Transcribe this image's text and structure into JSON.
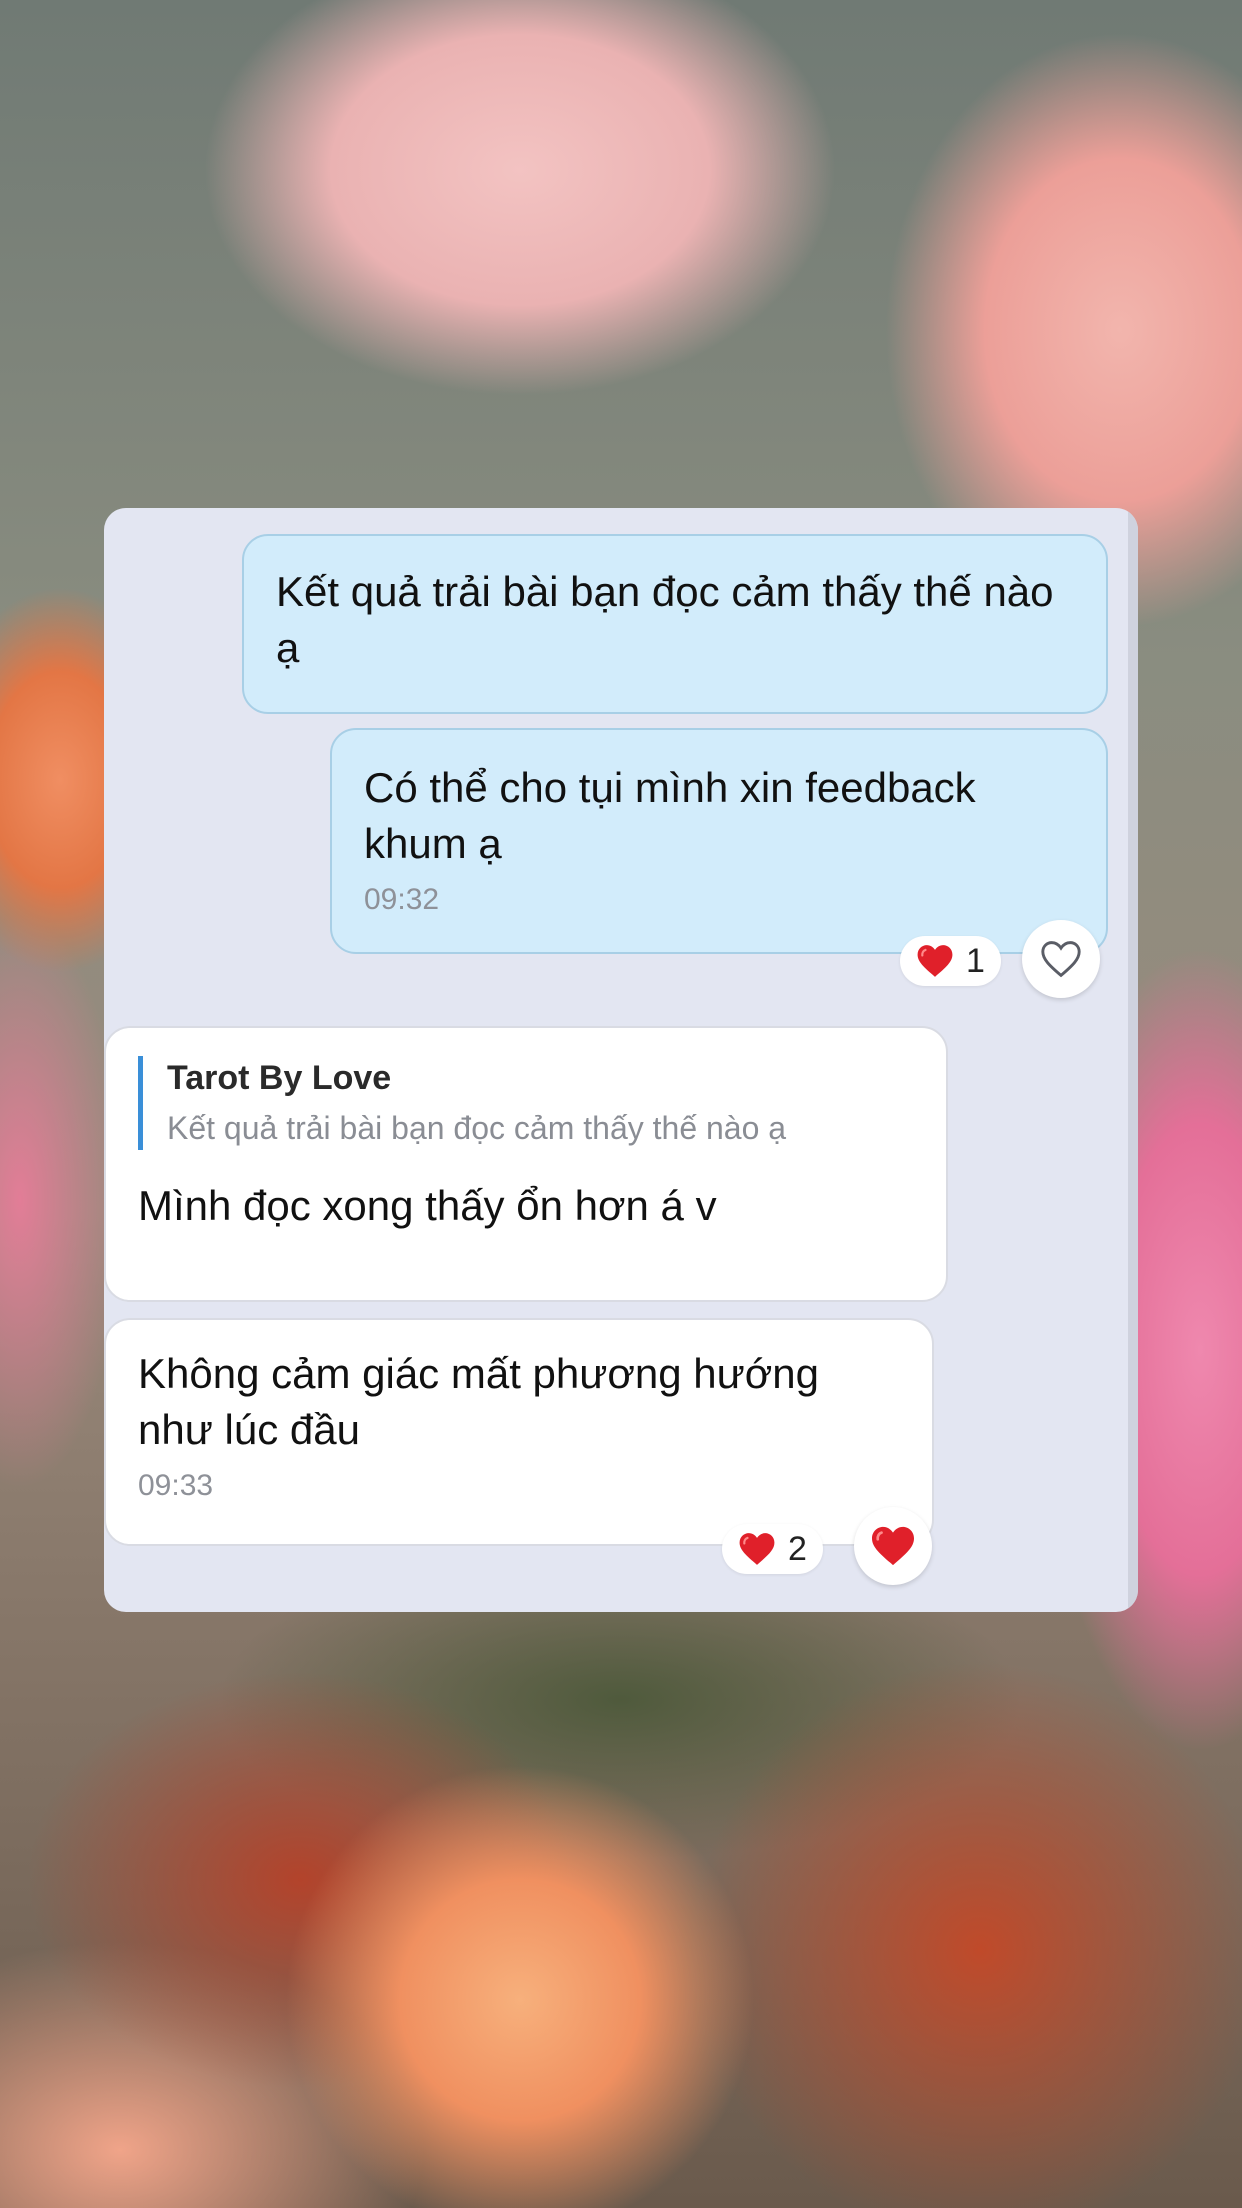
{
  "messages": [
    {
      "text": "Kết quả trải bài bạn đọc cảm thấy thế nào ạ"
    },
    {
      "text": "Có thể cho tụi mình xin feedback khum ạ",
      "time": "09:32",
      "reaction_count": "1"
    },
    {
      "quote_name": "Tarot By Love",
      "quote_text": "Kết quả trải bài bạn đọc cảm thấy thế nào ạ",
      "text": "Mình đọc xong thấy ổn hơn á v"
    },
    {
      "text": "Không cảm giác mất phương hướng như lúc đầu",
      "time": "09:33",
      "reaction_count": "2"
    }
  ],
  "colors": {
    "outgoing_bubble": "#d2ecfb",
    "incoming_bubble": "#ffffff",
    "quote_bar": "#3a8fd8",
    "heart": "#e0202a"
  },
  "icons": {
    "reaction": "red-heart-icon",
    "like_empty": "heart-outline-icon",
    "like_filled": "red-heart-icon"
  }
}
